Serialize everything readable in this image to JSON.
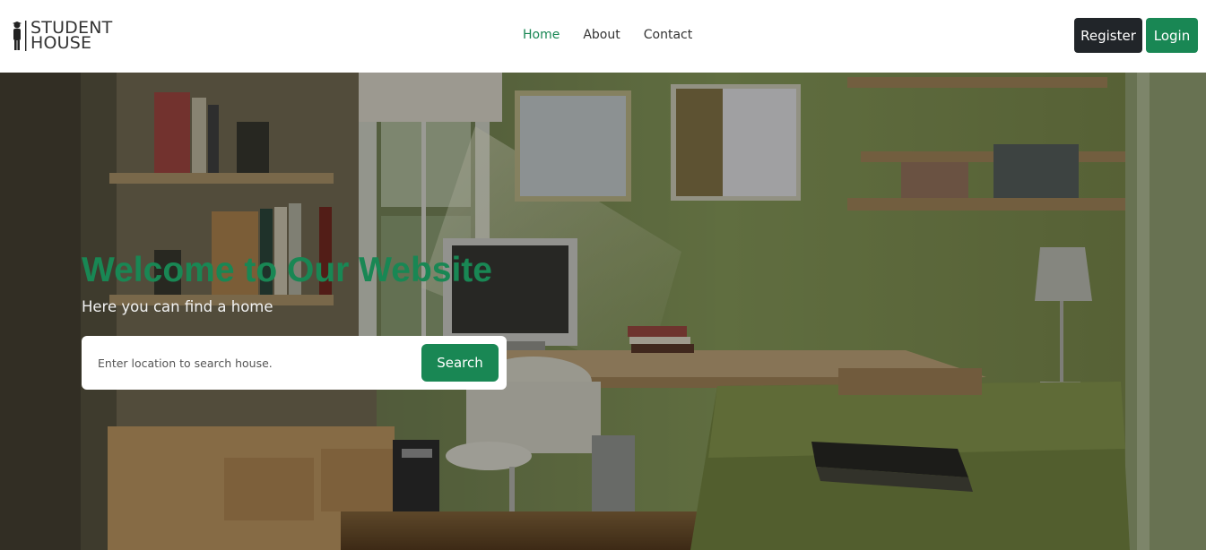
{
  "brand": {
    "line1": "STUDENT",
    "line2": "HOUSE"
  },
  "nav": {
    "items": [
      {
        "label": "Home",
        "active": true
      },
      {
        "label": "About",
        "active": false
      },
      {
        "label": "Contact",
        "active": false
      }
    ]
  },
  "auth": {
    "register_label": "Register",
    "login_label": "Login"
  },
  "hero": {
    "title": "Welcome to Our Website",
    "subtitle": "Here you can find a home",
    "search_placeholder": "Enter location to search house.",
    "search_label": "Search"
  },
  "colors": {
    "accent": "#198754",
    "dark": "#212529"
  }
}
